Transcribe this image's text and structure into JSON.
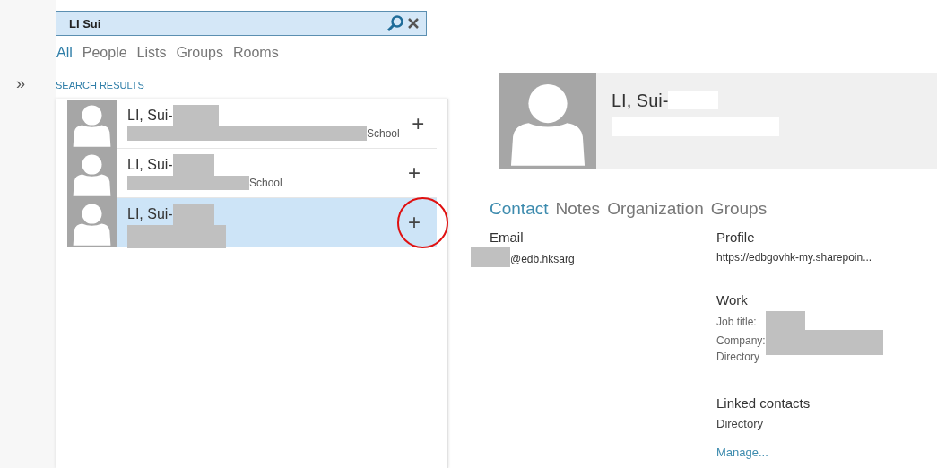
{
  "search": {
    "value": "LI Sui"
  },
  "filters": [
    {
      "label": "All",
      "selected": true
    },
    {
      "label": "People",
      "selected": false
    },
    {
      "label": "Lists",
      "selected": false
    },
    {
      "label": "Groups",
      "selected": false
    },
    {
      "label": "Rooms",
      "selected": false
    }
  ],
  "expand_glyph": "»",
  "results_heading": "SEARCH RESULTS",
  "results": [
    {
      "name": "LI, Sui-",
      "detail": "School",
      "selected": false,
      "circled": false
    },
    {
      "name": "LI, Sui-",
      "detail": "School",
      "selected": false,
      "circled": false
    },
    {
      "name": "LI, Sui-",
      "selected": true,
      "circled": true
    }
  ],
  "add_glyph": "+",
  "profile": {
    "name": "LI, Sui-"
  },
  "detail_tabs": [
    {
      "label": "Contact",
      "selected": true
    },
    {
      "label": "Notes",
      "selected": false
    },
    {
      "label": "Organization",
      "selected": false
    },
    {
      "label": "Groups",
      "selected": false
    }
  ],
  "email": {
    "heading": "Email",
    "value": "@edb.hksarg"
  },
  "profile_link": {
    "heading": "Profile",
    "value": "https://edbgovhk-my.sharepoin..."
  },
  "work": {
    "heading": "Work",
    "job_title_label": "Job title:",
    "company_label": "Company:",
    "source": "Directory"
  },
  "linked": {
    "heading": "Linked contacts",
    "source": "Directory",
    "manage": "Manage..."
  }
}
